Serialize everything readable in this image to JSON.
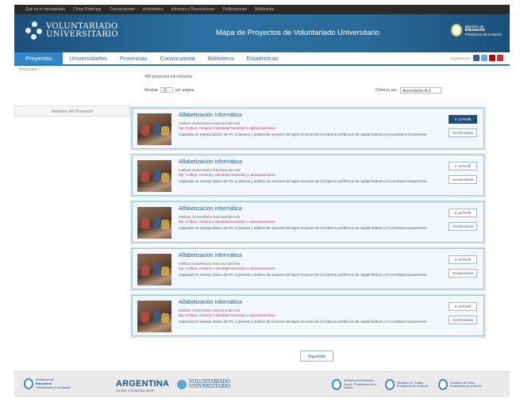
{
  "topbar": {
    "links": [
      "Qué es el voluntariado",
      "Cómo Participar",
      "Convocatorias",
      "Actividades",
      "Informes y Resoluciones",
      "Publicaciones",
      "Multimedia"
    ]
  },
  "header": {
    "logo_line1": "VOLUNTARIADO",
    "logo_line2": "UNIVERSITARIO",
    "title": "Mapa de Proyectos de Voluntariado Universitario",
    "ministry_line1": "Ministerio de",
    "ministry_line2": "Educación",
    "ministry_line3": "Presidencia de la Nación"
  },
  "nav": {
    "items": [
      "Proyectos",
      "Universidades",
      "Provincias",
      "Convocatoria",
      "Biblioteca",
      "Estadísticas"
    ],
    "active_index": 0,
    "social_label": "Seguinos en",
    "social_colors": [
      "#3b5998",
      "#55acee",
      "#bb0000",
      "#c4302b"
    ]
  },
  "breadcrumb": "Proyectos >",
  "results": {
    "count_text": "450 proyectos encontrados",
    "show_label": "Mostrar",
    "show_value": "10",
    "per_page_label": "por página",
    "order_label": "Ordenar por",
    "order_value": "Ascendente A-Z"
  },
  "filter": {
    "placeholder": "Nombre del Proyecto"
  },
  "projects": [
    {
      "title": "Alfabetización informática",
      "institution": "Instituto Universitario Nacional del Arte",
      "axis": "Eje: Cultura, Historia e Identidad Nacional y Latinoamericana",
      "description": "Capacitar en manejo básico de PC a jóvenes y adultos de sectores de bajos recursos de los barrios periféricos de capital federal y el conurbano bonaerense.",
      "profile_label": "Ir al Perfil",
      "geo_label": "Geolocalizar"
    },
    {
      "title": "Alfabetización informática",
      "institution": "Instituto Universitario Nacional del Arte",
      "axis": "Eje: Cultura, Historia e Identidad Nacional y Latinoamericana",
      "description": "Capacitar en manejo básico de PC a jóvenes y adultos de sectores de bajos recursos de los barrios periféricos de capital federal y el conurbano bonaerense.",
      "profile_label": "Ir al Perfil",
      "geo_label": "Geolocalizar"
    },
    {
      "title": "Alfabetización informática",
      "institution": "Instituto Universitario Nacional del Arte",
      "axis": "Eje: Cultura, Historia e Identidad Nacional y Latinoamericana",
      "description": "Capacitar en manejo básico de PC a jóvenes y adultos de sectores de bajos recursos de los barrios periféricos de capital federal y el conurbano bonaerense.",
      "profile_label": "Ir al Perfil",
      "geo_label": "Geolocalizar"
    },
    {
      "title": "Alfabetización informática",
      "institution": "Instituto Universitario Nacional del Arte",
      "axis": "Eje: Cultura, Historia e Identidad Nacional y Latinoamericana",
      "description": "Capacitar en manejo básico de PC a jóvenes y adultos de sectores de bajos recursos de los barrios periféricos de capital federal y el conurbano bonaerense.",
      "profile_label": "Ir al Perfil",
      "geo_label": "Geolocalizar"
    },
    {
      "title": "Alfabetización informática",
      "institution": "Instituto Universitario Nacional del Arte",
      "axis": "Eje: Cultura, Historia e Identidad Nacional y Latinoamericana",
      "description": "Capacitar en manejo básico de PC a jóvenes y adultos de sectores de bajos recursos de los barrios periféricos de capital federal y el conurbano bonaerense.",
      "profile_label": "Ir al Perfil",
      "geo_label": "Geolocalizar"
    }
  ],
  "pagination": {
    "next_label": "Siguiente"
  },
  "footer": {
    "ministry_line1": "Ministerio de",
    "ministry_line2": "Educación",
    "ministry_line3": "Presidencia de la Nación",
    "argentina": "ARGENTINA",
    "argentina_sub": "UN PAÍS CON BUENA GENTE",
    "logo_line1": "VOLUNTARIADO",
    "logo_line2": "UNIVERSITARIO",
    "partners": [
      "Ministerio de Desarrollo Social - Presidencia de la Nación",
      "Ministerio de Trabajo - Presidencia de la Nación",
      "Ministerio de Salud - Presidencia de la Nación"
    ]
  },
  "colors": {
    "header_blue": "#2c72a3",
    "nav_active": "#2f87c9",
    "link_blue": "#1f5e91",
    "axis_magenta": "#c0336e",
    "card_border": "#9fc3d6"
  }
}
